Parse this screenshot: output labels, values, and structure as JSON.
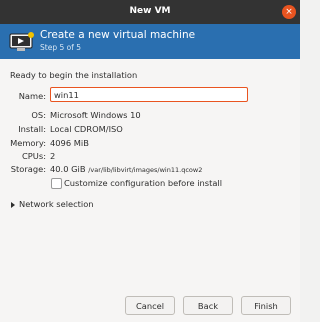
{
  "window": {
    "title": "New VM",
    "close_glyph": "×"
  },
  "banner": {
    "title": "Create a new virtual machine",
    "step": "Step 5 of 5"
  },
  "intro": "Ready to begin the installation",
  "form": {
    "name_label": "Name:",
    "name_value": "win11",
    "os_label": "OS:",
    "os_value": "Microsoft Windows 10",
    "install_label": "Install:",
    "install_value": "Local CDROM/ISO",
    "memory_label": "Memory:",
    "memory_value": "4096 MiB",
    "cpus_label": "CPUs:",
    "cpus_value": "2",
    "storage_label": "Storage:",
    "storage_size": "40.0 GiB",
    "storage_path": "/var/lib/libvirt/images/win11.qcow2",
    "customize_label": "Customize configuration before install",
    "customize_checked": false
  },
  "network": {
    "label": "Network selection",
    "expanded": false
  },
  "buttons": {
    "cancel": "Cancel",
    "back": "Back",
    "finish": "Finish"
  },
  "colors": {
    "titlebar": "#333333",
    "banner": "#2a6fb0",
    "accent": "#e95420"
  },
  "icons": {
    "close": "close-icon",
    "logo": "virtual-machine-icon",
    "expander": "triangle-right-icon"
  }
}
